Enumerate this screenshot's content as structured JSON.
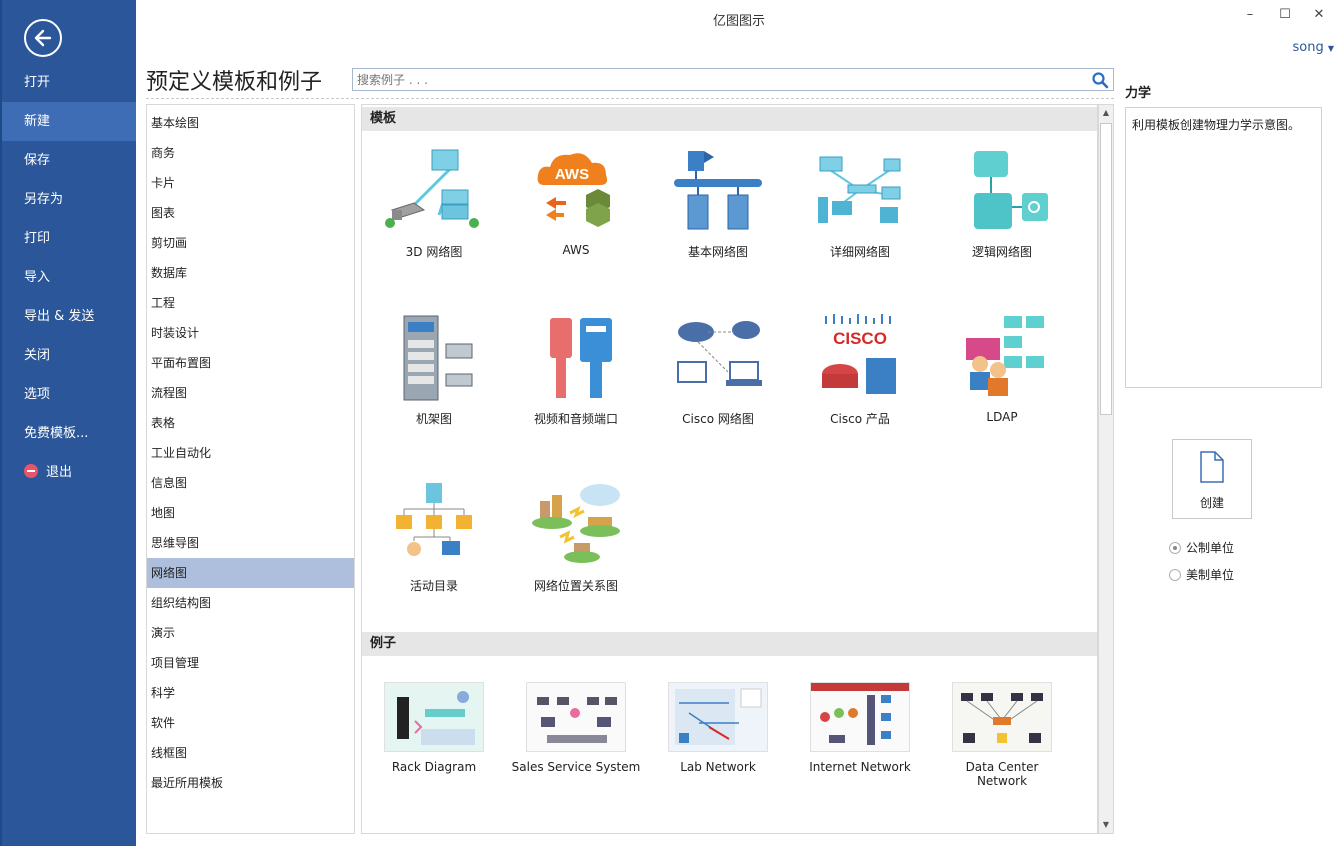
{
  "window": {
    "title": "亿图图示",
    "user": "song",
    "minimize_glyph": "–",
    "maximize_glyph": "☐",
    "close_glyph": "✕"
  },
  "nav": {
    "back_icon": "arrow-left-icon",
    "items": [
      "打开",
      "新建",
      "保存",
      "另存为",
      "打印",
      "导入",
      "导出 & 发送",
      "关闭",
      "选项",
      "免费模板...",
      "退出"
    ],
    "active_index": 1
  },
  "header": {
    "page_title": "预定义模板和例子",
    "search_placeholder": "搜索例子 . . ."
  },
  "categories": {
    "items": [
      "基本绘图",
      "商务",
      "卡片",
      "图表",
      "剪切画",
      "数据库",
      "工程",
      "时装设计",
      "平面布置图",
      "流程图",
      "表格",
      "工业自动化",
      "信息图",
      "地图",
      "思维导图",
      "网络图",
      "组织结构图",
      "演示",
      "项目管理",
      "科学",
      "软件",
      "线框图",
      "最近所用模板"
    ],
    "active_index": 15
  },
  "main": {
    "templates_header": "模板",
    "examples_header": "例子",
    "templates": [
      "3D 网络图",
      "AWS",
      "基本网络图",
      "详细网络图",
      "逻辑网络图",
      "机架图",
      "视频和音频端口",
      "Cisco 网络图",
      "Cisco 产品",
      "LDAP",
      "活动目录",
      "网络位置关系图"
    ],
    "aws_logo_text": "AWS",
    "cisco_logo_text": "CISCO",
    "examples": [
      "Rack Diagram",
      "Sales Service System",
      "Lab Network",
      "Internet Network",
      "Data Center Network"
    ]
  },
  "detail": {
    "title": "力学",
    "description": "利用模板创建物理力学示意图。",
    "create_label": "创建",
    "units": [
      "公制单位",
      "美制单位"
    ],
    "selected_unit": 0
  },
  "colors": {
    "nav_bg": "#2b579a",
    "nav_active": "#3e6db5",
    "category_active": "#adbfdd",
    "accent": "#2b579a"
  }
}
